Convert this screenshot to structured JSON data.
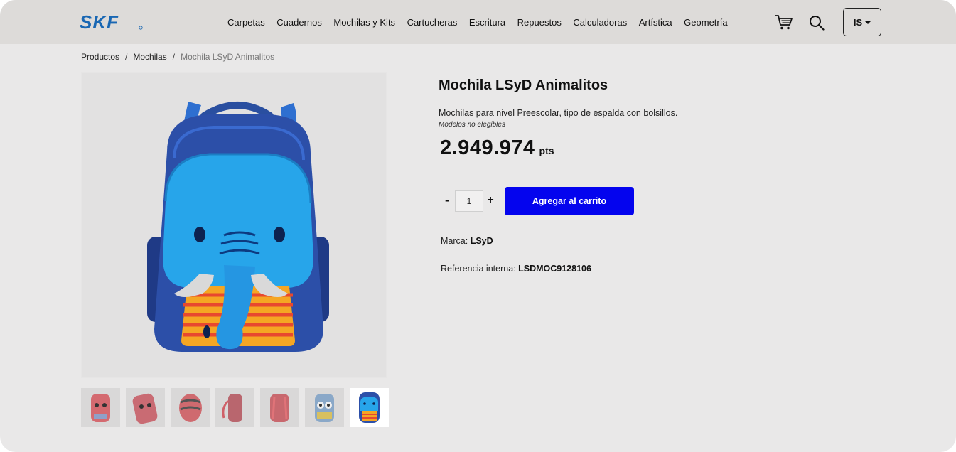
{
  "header": {
    "logo_text": "SKF",
    "nav": [
      "Carpetas",
      "Cuadernos",
      "Mochilas y Kits",
      "Cartucheras",
      "Escritura",
      "Repuestos",
      "Calculadoras",
      "Artística",
      "Geometría"
    ],
    "cart_icon": "cart-icon",
    "search_icon": "search-icon",
    "lang": "IS"
  },
  "breadcrumb": {
    "items": [
      "Productos",
      "Mochilas"
    ],
    "separator": "/",
    "current": "Mochila LSyD Animalitos"
  },
  "product": {
    "title": "Mochila LSyD Animalitos",
    "description": "Mochilas para nivel Preescolar, tipo de espalda con bolsillos.",
    "note": "Modelos no elegibles",
    "price": "2.949.974",
    "price_unit": "pts",
    "qty_minus": "-",
    "qty_value": "1",
    "qty_plus": "+",
    "add_to_cart": "Agregar al carrito",
    "brand_label": "Marca:",
    "brand_value": "LSyD",
    "ref_label": "Referencia interna:",
    "ref_value": "LSDMOC9128106"
  },
  "gallery": {
    "thumbnail_count": 7,
    "active_index": 6
  },
  "colors": {
    "accent": "#0404ee",
    "header_bg": "#dddbd9",
    "page_bg": "#e9e8e8",
    "logo_blue": "#1967b3"
  }
}
